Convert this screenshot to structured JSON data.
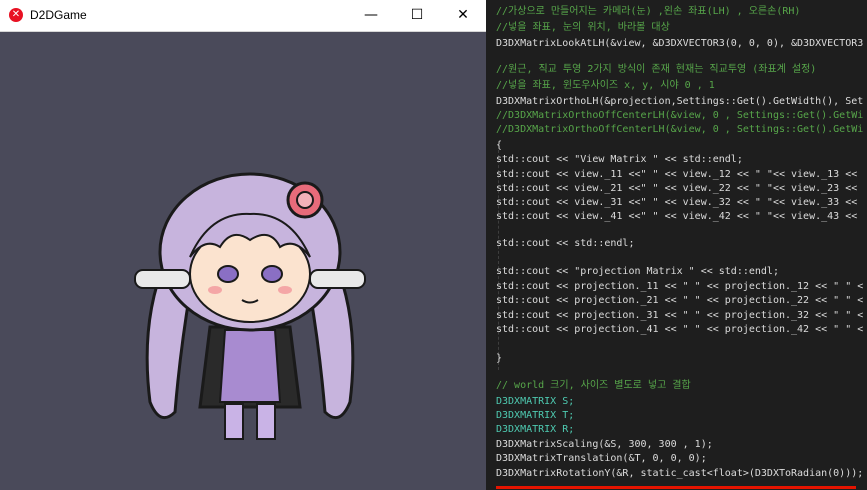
{
  "window": {
    "title": "D2DGame",
    "minimize_glyph": "—",
    "maximize_glyph": "☐",
    "close_glyph": "✕"
  },
  "code": {
    "lines": [
      "//가상으로 만들어지는 카메라(눈) ,왼손 좌표(LH) , 오른손(RH)",
      "//넣을 좌표, 눈의 위치, 바라볼 대상",
      "D3DXMatrixLookAtLH(&view, &D3DXVECTOR3(0, 0, 0), &D3DXVECTOR3",
      "",
      "//원근, 직교 투영 2가지 방식이 존재 현재는 직교투영 (좌표계 설정)",
      "//넣을 좌표, 윈도우사이즈 x, y, 시야 0 , 1",
      "D3DXMatrixOrthoLH(&projection,Settings::Get().GetWidth(), Set",
      "//D3DXMatrixOrthoOffCenterLH(&view, 0 , Settings::Get().GetWi",
      "//D3DXMatrixOrthoOffCenterLH(&view, 0 , Settings::Get().GetWi",
      "{",
      "std::cout << \"View Matrix \" << std::endl;",
      "std::cout << view._11 <<\" \" << view._12 << \" \"<< view._13 <<",
      "std::cout << view._21 <<\" \" << view._22 << \" \"<< view._23 <<",
      "std::cout << view._31 <<\" \" << view._32 << \" \"<< view._33 <<",
      "std::cout << view._41 <<\" \" << view._42 << \" \"<< view._43 <<",
      "",
      "std::cout << std::endl;",
      "",
      "std::cout << \"projection Matrix \" << std::endl;",
      "std::cout << projection._11 << \" \" << projection._12 << \" \" <",
      "std::cout << projection._21 << \" \" << projection._22 << \" \" <",
      "std::cout << projection._31 << \" \" << projection._32 << \" \" <",
      "std::cout << projection._41 << \" \" << projection._42 << \" \" <",
      "",
      "}",
      "",
      "// world 크기, 사이즈 별도로 넣고 결합",
      "D3DXMATRIX S;",
      "D3DXMATRIX T;",
      "D3DXMATRIX R;",
      "D3DXMatrixScaling(&S, 300, 300 , 1);",
      "D3DXMatrixTranslation(&T, 0, 0, 0);",
      "D3DXMatrixRotationY(&R, static_cast<float>(D3DXToRadian(0)));"
    ]
  },
  "colors": {
    "editor_bg": "#1e1e1e",
    "game_bg": "#4a4a5a",
    "comment": "#57a64a",
    "type": "#4ec9b0",
    "string": "#d69d85",
    "keyword": "#569cd6",
    "underline": "#e51400"
  }
}
